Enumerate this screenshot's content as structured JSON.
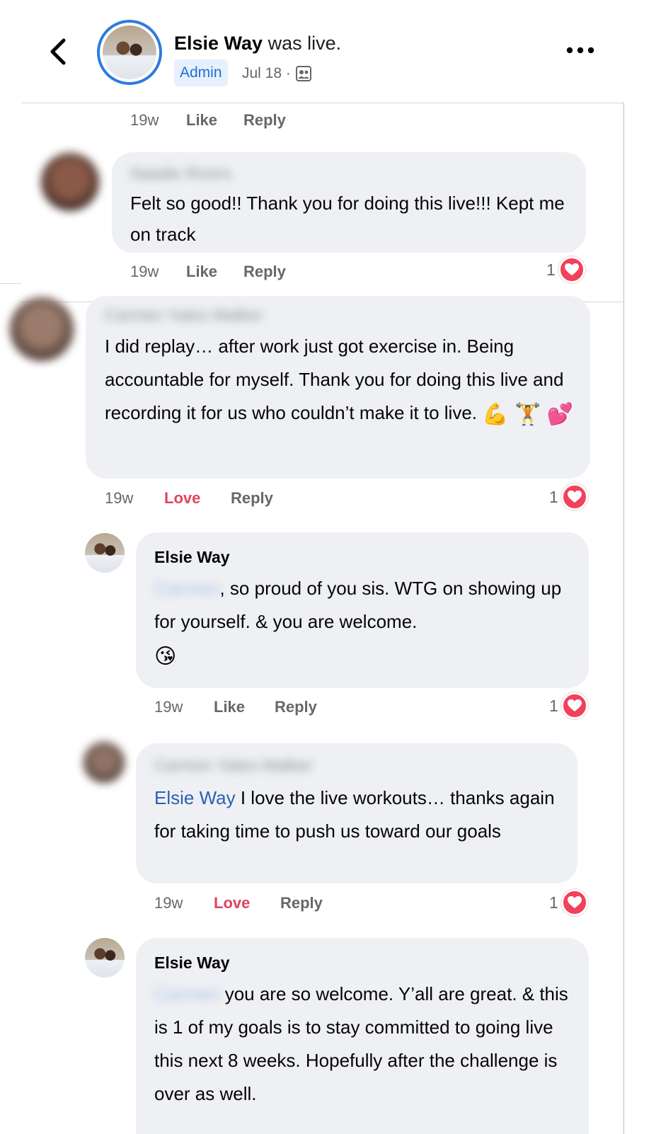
{
  "header": {
    "author_name": "Elsie Way",
    "status_text": "was live.",
    "admin_badge": "Admin",
    "date_text": "Jul 18 ·",
    "back_icon": "chevron-left-icon",
    "more_icon": "more-dots-icon",
    "audience_icon": "group-audience-icon"
  },
  "top_actions": {
    "time": "19w",
    "like": "Like",
    "reply": "Reply"
  },
  "comments": [
    {
      "author": "Natalie Rivers",
      "text": "Felt so good!! Thank you for doing this live!!! Kept me on track",
      "time": "19w",
      "reaction_label": "Like",
      "reply": "Reply",
      "reaction_count": "1"
    },
    {
      "author": "Carmen Yates-Walker",
      "text": "I did replay… after work just got exercise in. Being accountable for myself. Thank you for doing this live and recording it for us who couldn’t make it to live.",
      "emojis": "💪 🏋️ 💕",
      "time": "19w",
      "reaction_label": "Love",
      "reply": "Reply",
      "reaction_count": "1"
    },
    {
      "author": "Elsie Way",
      "mention": "Carmen",
      "text_after_mention": ", so proud of you sis. WTG on showing up for yourself. & you are welcome.",
      "emoji": "😘",
      "time": "19w",
      "reaction_label": "Like",
      "reply": "Reply",
      "reaction_count": "1"
    },
    {
      "author": "Carmen Yates-Walker",
      "mention": "Elsie Way",
      "text_after_mention": " I love the live workouts… thanks again for taking time to push us toward our goals",
      "time": "19w",
      "reaction_label": "Love",
      "reply": "Reply",
      "reaction_count": "1"
    },
    {
      "author": "Elsie Way",
      "mention": "Carmen",
      "text_after_mention": " you are so welcome. Y’all are great. & this is 1 of my goals is to stay committed to going live this next 8 weeks. Hopefully after the challenge is over as well."
    }
  ],
  "colors": {
    "accent": "#2d7be0",
    "love": "#e0445d",
    "heart": "#f1415b",
    "bubble": "#eff0f3",
    "muted": "#65676b"
  }
}
